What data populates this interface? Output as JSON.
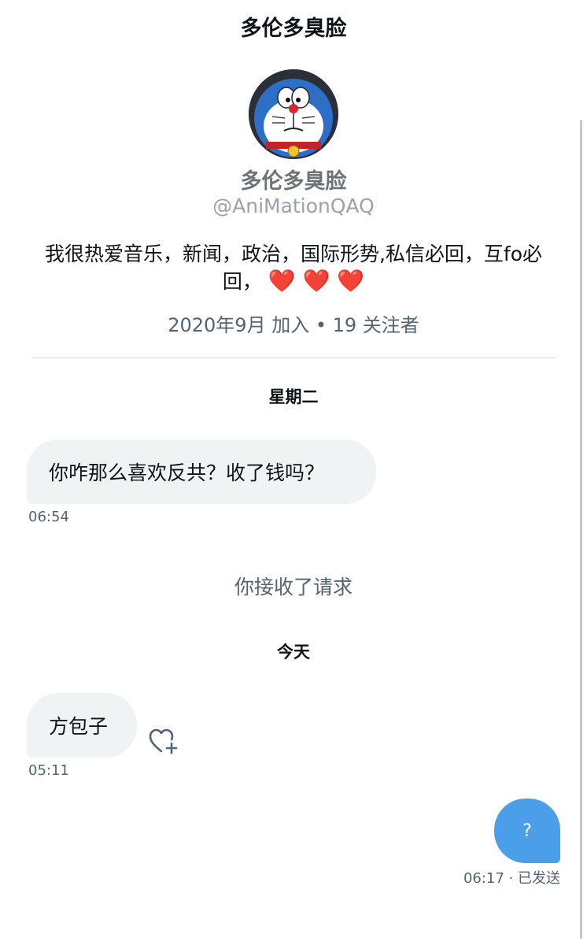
{
  "header": {
    "title": "多伦多臭脸"
  },
  "profile": {
    "name": "多伦多臭脸",
    "handle": "@AniMationQAQ",
    "bio_text": "我很热爱音乐，新闻，政治，国际形势,私信必回，互fo必回，",
    "bio_hearts": "❤️ ❤️ ❤️",
    "meta": "2020年9月 加入 • 19 关注者"
  },
  "conversation": {
    "day1_label": "星期二",
    "message1": {
      "text": "你咋那么喜欢反共？收了钱吗？",
      "time": "06:54"
    },
    "system_notice": "你接收了请求",
    "day2_label": "今天",
    "message2": {
      "text": "方包子",
      "time": "05:11"
    },
    "message3": {
      "text": "?",
      "time": "06:17 · 已发送"
    }
  },
  "colors": {
    "incoming_bubble": "#eff3f4",
    "outgoing_bubble": "#4a9fe8",
    "secondary_text": "#536471"
  },
  "icons": {
    "react": "heart-plus-icon"
  }
}
